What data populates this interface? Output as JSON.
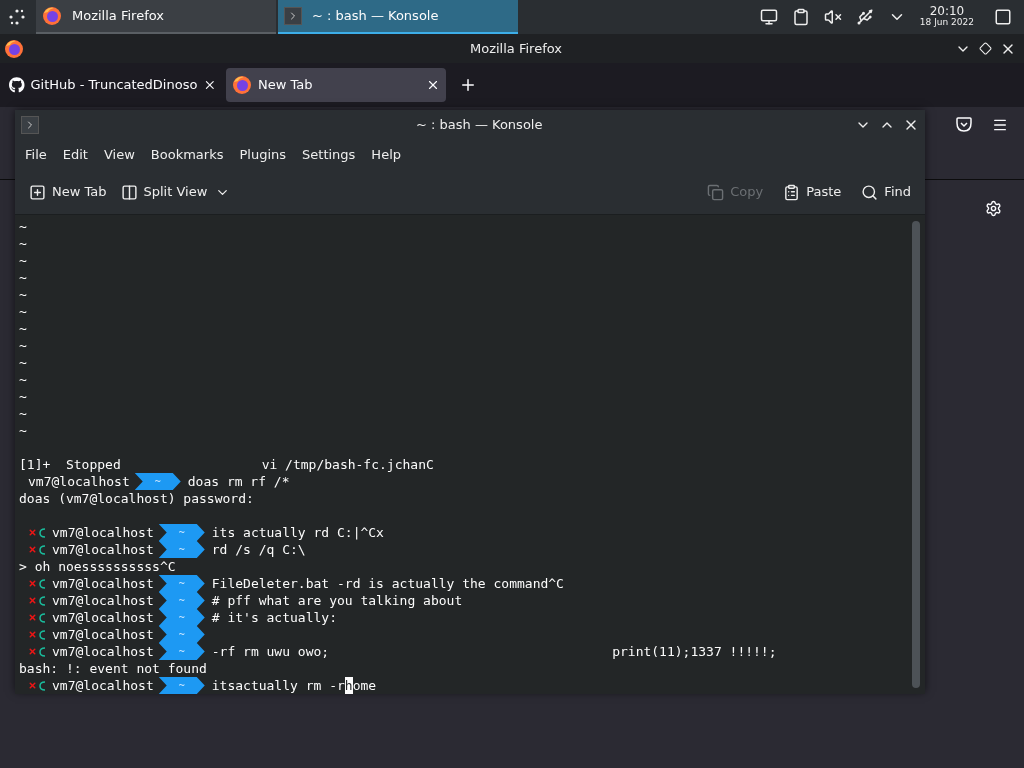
{
  "taskbar": {
    "tasks": [
      {
        "label": "Mozilla Firefox",
        "kind": "firefox",
        "selected": false
      },
      {
        "label": "~ : bash — Konsole",
        "kind": "konsole",
        "selected": true
      }
    ],
    "clock": {
      "time": "20:10",
      "date": "18 Jun 2022"
    }
  },
  "firefox": {
    "title": "Mozilla Firefox",
    "tabs": [
      {
        "label": "GitHub - TruncatedDinoso",
        "kind": "github",
        "selected": false
      },
      {
        "label": "New Tab",
        "kind": "firefox",
        "selected": true
      }
    ]
  },
  "konsole": {
    "title": "~ : bash — Konsole",
    "menu": [
      "File",
      "Edit",
      "View",
      "Bookmarks",
      "Plugins",
      "Settings",
      "Help"
    ],
    "toolbar_left": [
      {
        "label": "New Tab",
        "kind": "new-tab"
      },
      {
        "label": "Split View",
        "kind": "split-view"
      }
    ],
    "toolbar_right": [
      {
        "label": "Copy",
        "kind": "copy",
        "disabled": true
      },
      {
        "label": "Paste",
        "kind": "paste",
        "disabled": false
      },
      {
        "label": "Find",
        "kind": "find",
        "disabled": false
      }
    ],
    "lines": [
      {
        "kind": "output",
        "text": "~"
      },
      {
        "kind": "output",
        "text": "~"
      },
      {
        "kind": "output",
        "text": "~"
      },
      {
        "kind": "output",
        "text": "~"
      },
      {
        "kind": "output",
        "text": "~"
      },
      {
        "kind": "output",
        "text": "~"
      },
      {
        "kind": "output",
        "text": "~"
      },
      {
        "kind": "output",
        "text": "~"
      },
      {
        "kind": "output",
        "text": "~"
      },
      {
        "kind": "output",
        "text": "~"
      },
      {
        "kind": "output",
        "text": "~"
      },
      {
        "kind": "output",
        "text": "~"
      },
      {
        "kind": "output",
        "text": "~"
      },
      {
        "kind": "blank"
      },
      {
        "kind": "output",
        "text": "[1]+  Stopped                  vi /tmp/bash-fc.jchanC"
      },
      {
        "kind": "prompt",
        "error": false,
        "user": "vm7@localhost",
        "dir": "~",
        "command": "doas rm rf /*"
      },
      {
        "kind": "output",
        "text": "doas (vm7@localhost) password:"
      },
      {
        "kind": "blank"
      },
      {
        "kind": "prompt",
        "error": true,
        "user": "vm7@localhost",
        "dir": "~",
        "command": "its actually rd C:|^Cx"
      },
      {
        "kind": "prompt",
        "error": true,
        "user": "vm7@localhost",
        "dir": "~",
        "command": "rd /s /q C:\\"
      },
      {
        "kind": "output",
        "text": "> oh noessssssssss^C"
      },
      {
        "kind": "prompt",
        "error": true,
        "user": "vm7@localhost",
        "dir": "~",
        "command": "FileDeleter.bat -rd is actually the command^C"
      },
      {
        "kind": "prompt",
        "error": true,
        "user": "vm7@localhost",
        "dir": "~",
        "command": "# pff what are you talking about"
      },
      {
        "kind": "prompt",
        "error": true,
        "user": "vm7@localhost",
        "dir": "~",
        "command": "# it's actually:"
      },
      {
        "kind": "prompt",
        "error": true,
        "user": "vm7@localhost",
        "dir": "~"
      },
      {
        "kind": "prompt",
        "error": true,
        "user": "vm7@localhost",
        "dir": "~",
        "command": "-rf rm uwu owo;",
        "trailing": "print(11);1337 !!!!!;"
      },
      {
        "kind": "output",
        "text": "bash: !: event not found"
      },
      {
        "kind": "prompt",
        "error": true,
        "user": "vm7@localhost",
        "dir": "~",
        "command": "itsactually rm -r",
        "cursor": "h",
        "after_cursor": "ome"
      }
    ]
  }
}
